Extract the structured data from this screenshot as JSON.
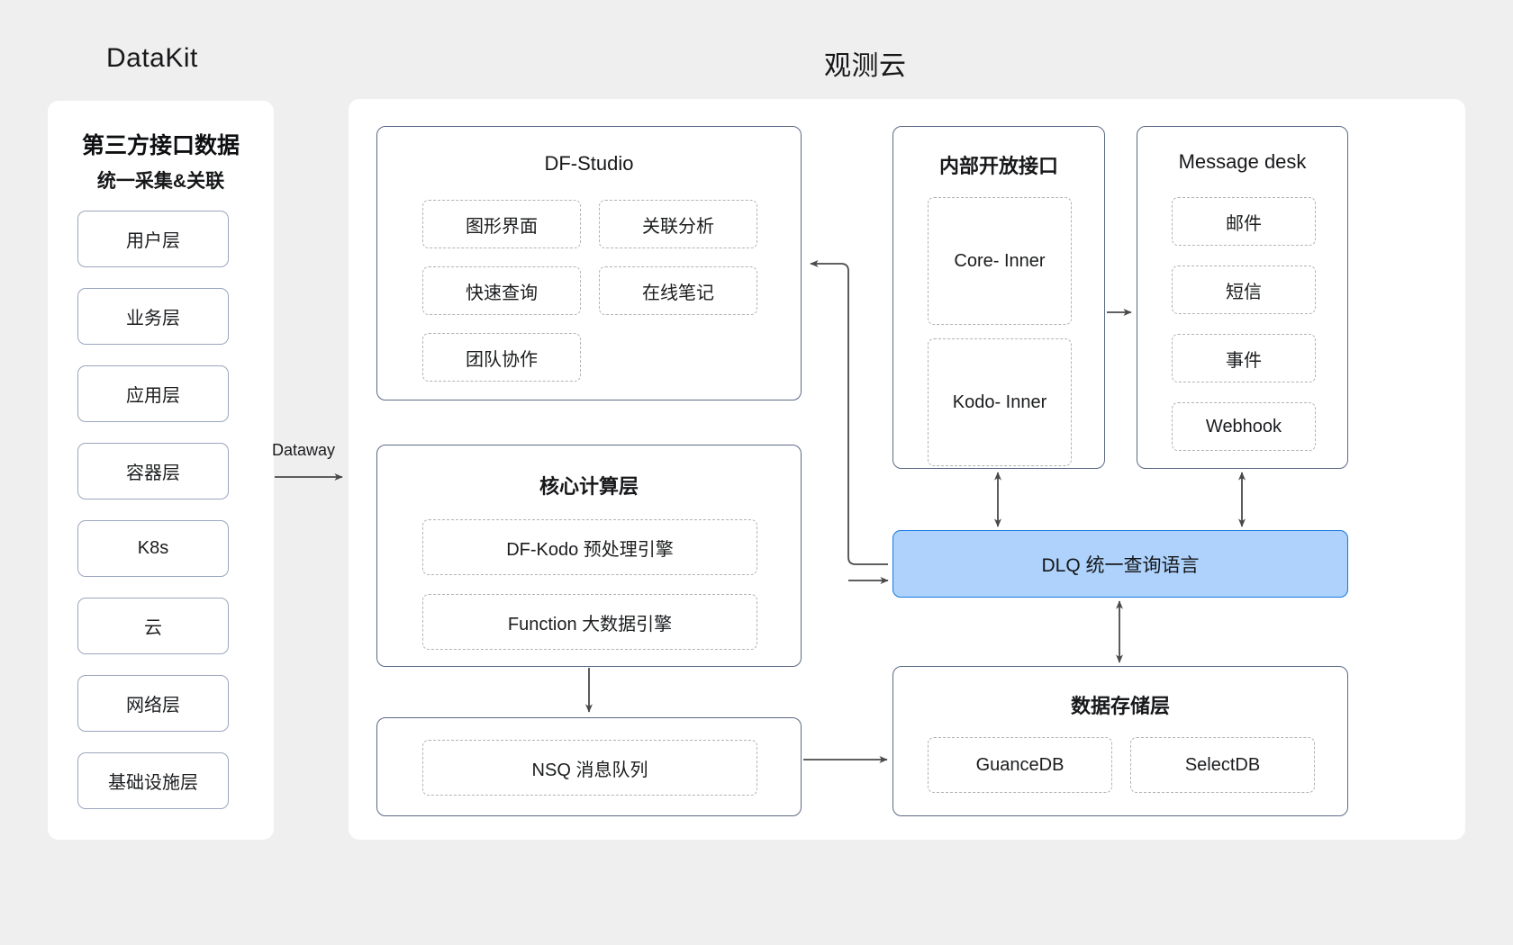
{
  "titles": {
    "left": "DataKit",
    "right": "观测云"
  },
  "sidebar": {
    "heading": "第三方接口数据",
    "subheading": "统一采集&关联",
    "items": [
      {
        "label": "用户层"
      },
      {
        "label": "业务层"
      },
      {
        "label": "应用层"
      },
      {
        "label": "容器层"
      },
      {
        "label": "K8s"
      },
      {
        "label": "云"
      },
      {
        "label": "网络层"
      },
      {
        "label": "基础设施层"
      }
    ]
  },
  "connectors": {
    "dataway_label": "Dataway"
  },
  "panels": {
    "df_studio": {
      "title": "DF-Studio",
      "items": [
        {
          "label": "图形界面"
        },
        {
          "label": "关联分析"
        },
        {
          "label": "快速查询"
        },
        {
          "label": "在线笔记"
        },
        {
          "label": "团队协作"
        }
      ]
    },
    "core_compute": {
      "title": "核心计算层",
      "items": [
        {
          "label": "DF-Kodo 预处理引擎"
        },
        {
          "label": "Function 大数据引擎"
        }
      ]
    },
    "nsq": {
      "items": [
        {
          "label": "NSQ 消息队列"
        }
      ]
    },
    "inner_api": {
      "title": "内部开放接口",
      "items": [
        {
          "label": "Core- Inner"
        },
        {
          "label": "Kodo- Inner"
        }
      ]
    },
    "message_desk": {
      "title": "Message desk",
      "items": [
        {
          "label": "邮件"
        },
        {
          "label": "短信"
        },
        {
          "label": "事件"
        },
        {
          "label": "Webhook"
        }
      ]
    },
    "dlq": {
      "label": "DLQ 统一查询语言"
    },
    "storage": {
      "title": "数据存储层",
      "items": [
        {
          "label": "GuanceDB"
        },
        {
          "label": "SelectDB"
        }
      ]
    }
  },
  "colors": {
    "background": "#efefef",
    "card": "#ffffff",
    "group_border": "#5c6a86",
    "dashed_border": "#b3b3b3",
    "side_border": "#9aa7bd",
    "accent_fill": "#aed2fb",
    "accent_border": "#1878e0",
    "arrow": "#4a4a4a",
    "text": "#17181a"
  }
}
